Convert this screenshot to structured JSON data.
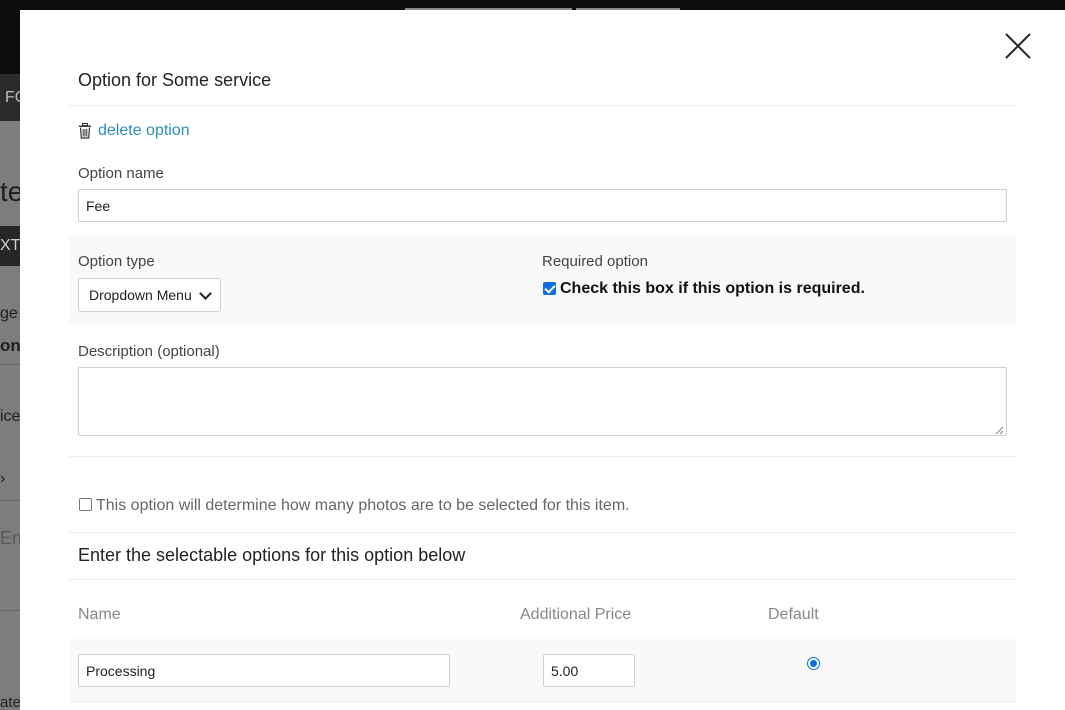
{
  "background": {
    "nav_fragment": "FO",
    "heading_fragment": "te",
    "dark_button_fragment": "XT",
    "text_fragment_1": "ge",
    "text_fragment_2": "on",
    "text_fragment_3": "ice",
    "text_fragment_4": "›",
    "text_fragment_5": "En",
    "text_fragment_6": "ate"
  },
  "modal": {
    "title": "Option for Some service",
    "delete_label": "delete option",
    "option_name": {
      "label": "Option name",
      "value": "Fee"
    },
    "option_type": {
      "label": "Option type",
      "selected": "Dropdown Menu"
    },
    "required": {
      "label": "Required option",
      "checkbox_label": "Check this box if this option is required.",
      "checked": true
    },
    "description": {
      "label": "Description (optional)",
      "value": ""
    },
    "photos_checkbox": {
      "label": "This option will determine how many photos are to be selected for this item.",
      "checked": false
    },
    "selectable_title": "Enter the selectable options for this option below",
    "table": {
      "headers": {
        "name": "Name",
        "price": "Additional Price",
        "default": "Default"
      },
      "rows": [
        {
          "name": "Processing",
          "price": "5.00",
          "default": true
        }
      ]
    }
  },
  "colors": {
    "link": "#2a8fbd",
    "accent": "#0b6fdc"
  }
}
